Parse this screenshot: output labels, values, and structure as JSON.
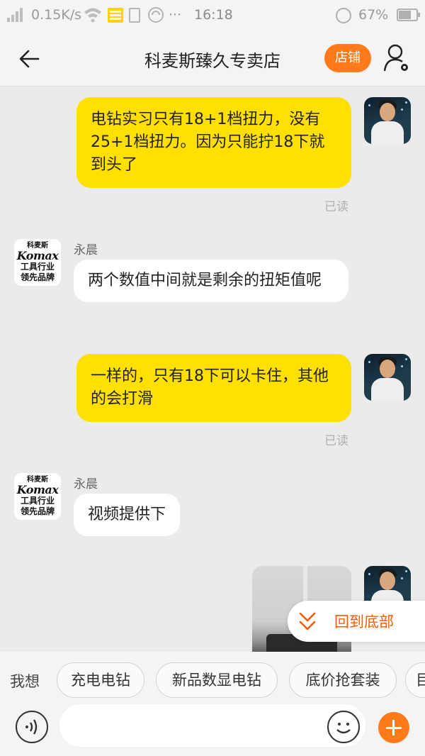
{
  "status_bar": {
    "network_speed": "0.15K/s",
    "time": "16:18",
    "battery": "67%",
    "more": "···"
  },
  "header": {
    "title": "科麦斯臻久专卖店",
    "shop_button": "店铺"
  },
  "colors": {
    "accent": "#ff7a1a",
    "my_bubble": "#ffe000",
    "shop_bubble": "#ffffff",
    "back_to_bottom_text": "#ff5a00"
  },
  "shop_avatar": {
    "line1": "科麦斯",
    "line2": "Komax",
    "line3": "工具行业",
    "line4": "领先品牌"
  },
  "messages": [
    {
      "from": "me",
      "text": "电钻实习只有18+1档扭力，没有25+1档扭力。因为只能拧18下就到头了",
      "status": "已读"
    },
    {
      "from": "shop",
      "sender": "永晨",
      "text": "两个数值中间就是剩余的扭矩值呢"
    },
    {
      "from": "me",
      "text": "一样的，只有18下可以卡住，其他的会打滑",
      "status": "已读"
    },
    {
      "from": "shop",
      "sender": "永晨",
      "text": "视频提供下"
    },
    {
      "from": "me",
      "type": "video"
    }
  ],
  "back_to_bottom": "回到底部",
  "quick_replies": {
    "lead": "我想",
    "chips": [
      "充电电钻",
      "新品数显电钻",
      "底价抢套装",
      "目"
    ]
  },
  "input": {
    "placeholder": ""
  }
}
